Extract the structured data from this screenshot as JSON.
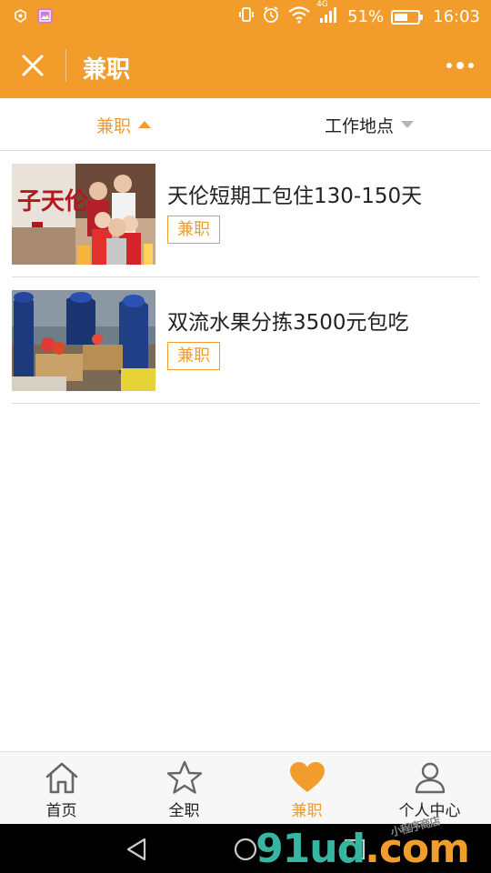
{
  "status_bar": {
    "network": "4G",
    "battery_text": "51%",
    "battery_level": 0.51,
    "time": "16:03"
  },
  "header": {
    "title": "兼职"
  },
  "filters": [
    {
      "label": "兼职",
      "active": true
    },
    {
      "label": "工作地点",
      "active": false
    }
  ],
  "jobs": [
    {
      "title": "天伦短期工包住130-150天",
      "tag": "兼职"
    },
    {
      "title": "双流水果分拣3500元包吃",
      "tag": "兼职"
    }
  ],
  "bottom_nav": [
    {
      "label": "首页",
      "icon": "home-icon"
    },
    {
      "label": "全职",
      "icon": "star-icon"
    },
    {
      "label": "兼职",
      "icon": "heart-icon",
      "active": true
    },
    {
      "label": "个人中心",
      "icon": "person-icon"
    }
  ],
  "watermark": {
    "part1": "91ud",
    "part2": ".com",
    "small": "小程序商店"
  },
  "colors": {
    "accent": "#f29c2b",
    "inactive_icon": "#666666",
    "divider": "#dedede"
  }
}
